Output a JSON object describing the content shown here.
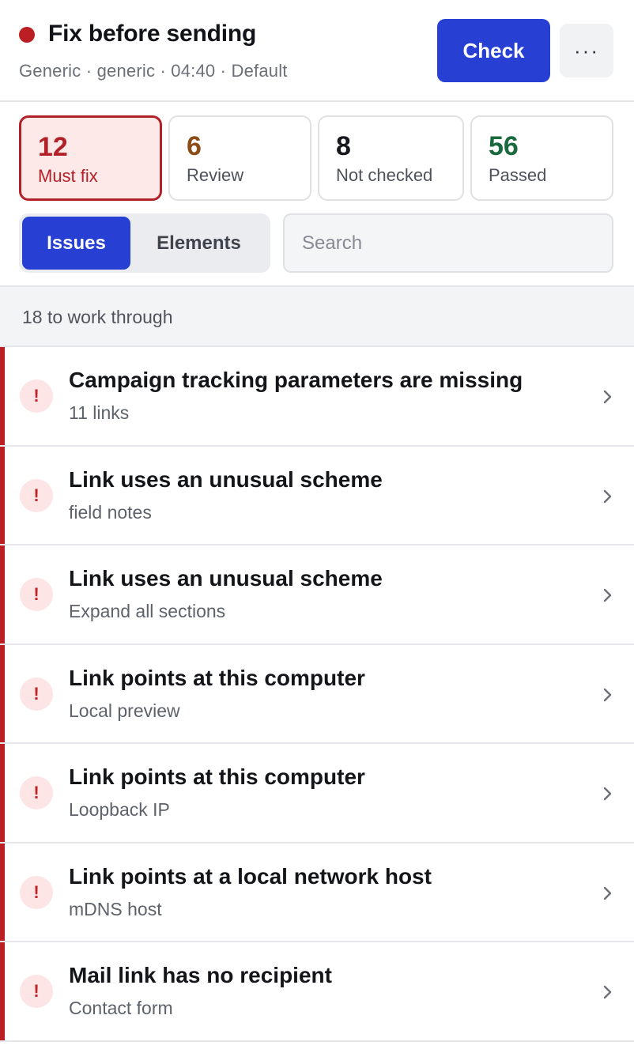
{
  "header": {
    "title": "Fix before sending",
    "meta": "Generic · generic · 04:40 · Default",
    "check_label": "Check",
    "more_label": "···",
    "status_color": "#bb1f24"
  },
  "summary": {
    "must_fix": {
      "count": "12",
      "label": "Must fix"
    },
    "review": {
      "count": "6",
      "label": "Review"
    },
    "not_checked": {
      "count": "8",
      "label": "Not checked"
    },
    "passed": {
      "count": "56",
      "label": "Passed"
    }
  },
  "view_toggle": {
    "issues_label": "Issues",
    "elements_label": "Elements",
    "selected": "Issues"
  },
  "search": {
    "placeholder": "Search",
    "value": ""
  },
  "list_header": "18 to work through",
  "issues": [
    {
      "title": "Campaign tracking parameters are missing",
      "subtitle": "11 links",
      "severity": "must-fix",
      "icon": "!"
    },
    {
      "title": "Link uses an unusual scheme",
      "subtitle": "field notes",
      "severity": "must-fix",
      "icon": "!"
    },
    {
      "title": "Link uses an unusual scheme",
      "subtitle": "Expand all sections",
      "severity": "must-fix",
      "icon": "!"
    },
    {
      "title": "Link points at this computer",
      "subtitle": "Local preview",
      "severity": "must-fix",
      "icon": "!"
    },
    {
      "title": "Link points at this computer",
      "subtitle": "Loopback IP",
      "severity": "must-fix",
      "icon": "!"
    },
    {
      "title": "Link points at a local network host",
      "subtitle": "mDNS host",
      "severity": "must-fix",
      "icon": "!"
    },
    {
      "title": "Mail link has no recipient",
      "subtitle": "Contact form",
      "severity": "must-fix",
      "icon": "!"
    }
  ],
  "colors": {
    "accent": "#2740d3",
    "must_fix": "#b32128",
    "review": "#8a4d18",
    "passed": "#1b6a3e"
  }
}
